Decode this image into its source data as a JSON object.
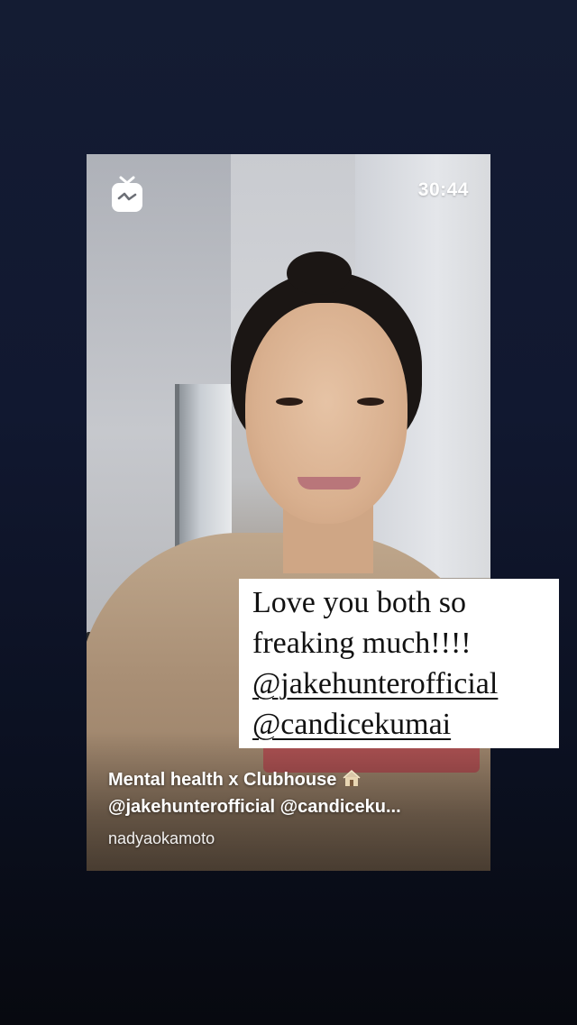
{
  "video": {
    "timer": "30:44",
    "caption_title": "Mental health x Clubhouse",
    "caption_mentions": "@jakehunterofficial @candiceku...",
    "author": "nadyaokamoto",
    "icons": {
      "app": "igtv-icon",
      "title_emoji": "house-icon"
    }
  },
  "sticker": {
    "line1": "Love you both so",
    "line2": "freaking much!!!!",
    "mention1": "@jakehunterofficial",
    "mention2": "@candicekumai"
  },
  "colors": {
    "background_top": "#141c33",
    "background_bottom": "#07090f",
    "sticker_bg": "#ffffff",
    "text_white": "#ffffff"
  }
}
